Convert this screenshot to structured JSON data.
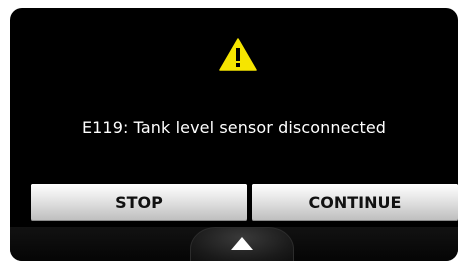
{
  "dialog": {
    "icon": "warning-icon",
    "message": "E119: Tank level sensor disconnected"
  },
  "buttons": {
    "stop_label": "STOP",
    "continue_label": "CONTINUE"
  },
  "navigation": {
    "menu_toggle_icon": "up-arrow-icon"
  },
  "colors": {
    "screen_background": "#000000",
    "warning_fill": "#f6e500",
    "text": "#ffffff"
  }
}
